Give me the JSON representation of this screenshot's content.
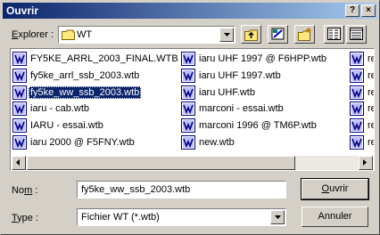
{
  "window": {
    "title": "Ouvrir",
    "help_glyph": "?",
    "close_glyph": "×"
  },
  "lookin": {
    "label_prefix": "E",
    "label_rest": "xplorer :",
    "folder": "WT"
  },
  "files": [
    {
      "name": "FY5KE_ARRL_2003_FINAL.WTB",
      "selected": false
    },
    {
      "name": "fy5ke_arrl_ssb_2003.wtb",
      "selected": false
    },
    {
      "name": "fy5ke_ww_ssb_2003.wtb",
      "selected": true
    },
    {
      "name": "iaru - cab.wtb",
      "selected": false
    },
    {
      "name": "IARU - essai.wtb",
      "selected": false
    },
    {
      "name": "iaru 2000 @ F5FNY.wtb",
      "selected": false
    },
    {
      "name": "iaru UHF 1997 @ F6HPP.wtb",
      "selected": false
    },
    {
      "name": "iaru UHF 1997.wtb",
      "selected": false
    },
    {
      "name": "iaru UHF.wtb",
      "selected": false
    },
    {
      "name": "marconi - essai.wtb",
      "selected": false
    },
    {
      "name": "marconi 1996 @ TM6P.wtb",
      "selected": false
    },
    {
      "name": "new.wtb",
      "selected": false
    },
    {
      "name": "re",
      "selected": false
    },
    {
      "name": "re",
      "selected": false
    },
    {
      "name": "re",
      "selected": false
    },
    {
      "name": "re",
      "selected": false
    },
    {
      "name": "re",
      "selected": false
    },
    {
      "name": "re",
      "selected": false
    }
  ],
  "filename": {
    "label_prefix": "No",
    "label_u": "m",
    "label_rest": " :",
    "value": "fy5ke_ww_ssb_2003.wtb"
  },
  "filetype": {
    "label_prefix": "",
    "label_u": "T",
    "label_rest": "ype :",
    "value": "Fichier WT (*.wtb)"
  },
  "buttons": {
    "open_u": "O",
    "open_rest": "uvrir",
    "cancel": "Annuler"
  },
  "colors": {
    "title_start": "#0a246a",
    "title_end": "#a6caf0",
    "selection": "#0a246a",
    "face": "#d4d0c8"
  }
}
